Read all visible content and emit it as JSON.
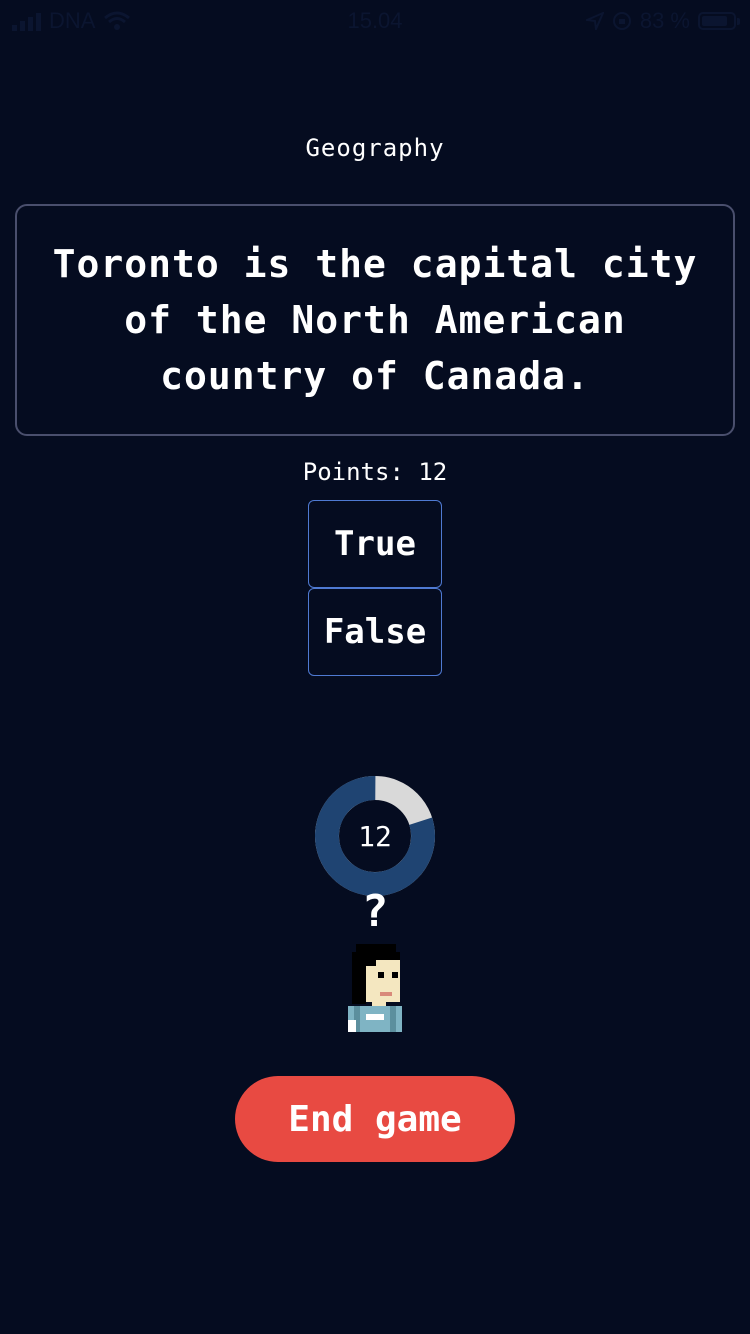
{
  "status_bar": {
    "carrier": "DNA",
    "time": "15.04",
    "battery_text": "83 %",
    "battery_level": 0.83
  },
  "quiz": {
    "category": "Geography",
    "question": "Toronto is the capital city of the North American country of Canada.",
    "points_label": "Points: 12",
    "answers": {
      "true_label": "True",
      "false_label": "False"
    }
  },
  "timer": {
    "value": "12",
    "remaining_fraction": 0.8
  },
  "thinking_mark": "?",
  "end_button_label": "End game",
  "colors": {
    "background": "#050c20",
    "card_border": "#4a4f6d",
    "answer_border": "#4f7ad2",
    "timer_active": "#1f4472",
    "timer_track": "#d9d9d9",
    "end_button": "#e84a42"
  }
}
